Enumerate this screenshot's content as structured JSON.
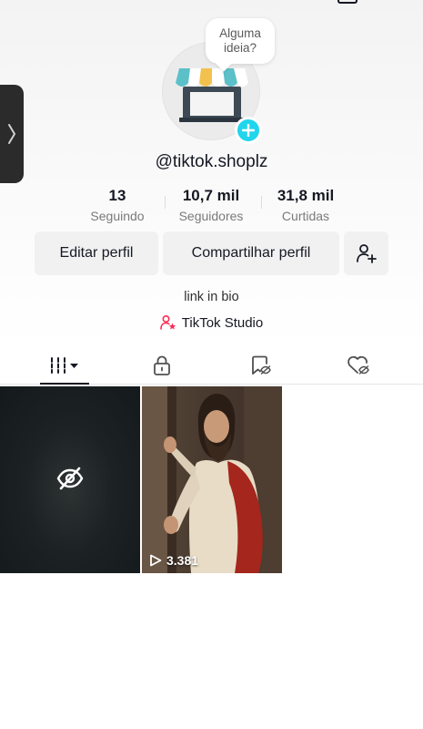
{
  "speech_bubble": {
    "line1": "Alguma",
    "line2": "ideia?"
  },
  "profile": {
    "username": "@tiktok.shoplz"
  },
  "stats": [
    {
      "value": "13",
      "label": "Seguindo"
    },
    {
      "value": "10,7 mil",
      "label": "Seguidores"
    },
    {
      "value": "31,8 mil",
      "label": "Curtidas"
    }
  ],
  "actions": {
    "edit_label": "Editar perfil",
    "share_label": "Compartilhar perfil",
    "add_friend_icon": "person-add-icon"
  },
  "bio": {
    "text": "link in bio"
  },
  "studio_link": {
    "label": "TikTok Studio",
    "icon": "person-star-icon"
  },
  "tabs": [
    {
      "name": "videos",
      "icon": "grid-bars-icon",
      "active": true,
      "has_dropdown": true
    },
    {
      "name": "private",
      "icon": "lock-icon",
      "active": false
    },
    {
      "name": "reposts",
      "icon": "bookmark-hidden-icon",
      "active": false
    },
    {
      "name": "liked",
      "icon": "heart-hidden-icon",
      "active": false
    }
  ],
  "videos": [
    {
      "type": "hidden",
      "icon": "eye-off-icon"
    },
    {
      "type": "video",
      "views": "3.381",
      "icon": "play-outline-icon"
    }
  ],
  "colors": {
    "accent": "#20d5ec",
    "studio_pink": "#fe2c55",
    "text": "#161823",
    "muted": "#7a7a7a",
    "button_bg": "#f1f1f2"
  }
}
